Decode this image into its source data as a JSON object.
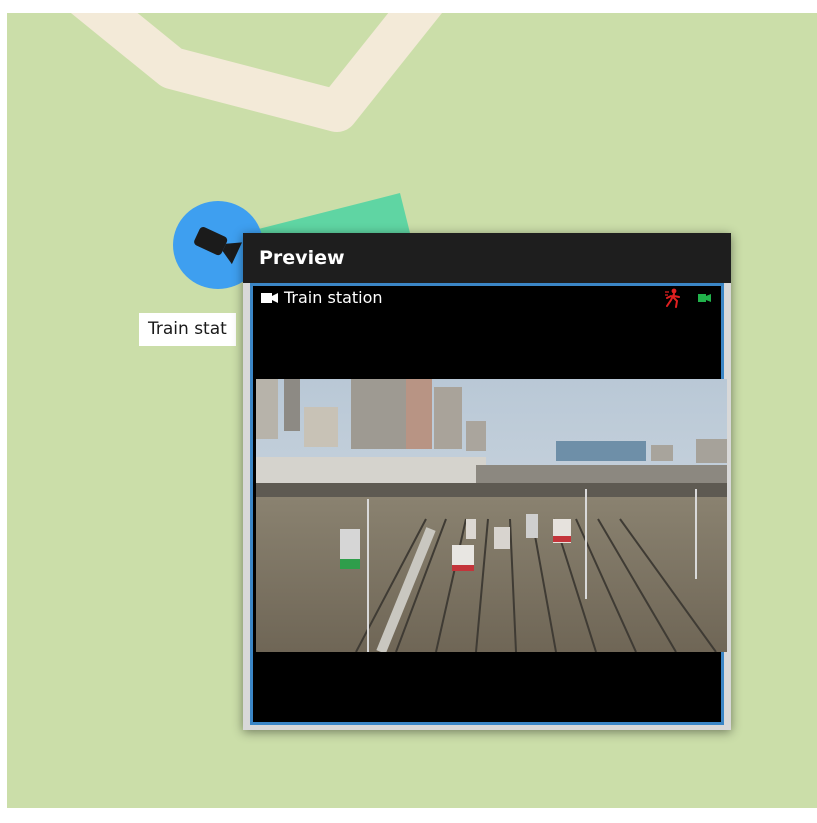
{
  "map": {
    "background_color": "#cbdea9",
    "road_color": "#f3ead8",
    "fov_color": "#5fd5a3"
  },
  "camera_marker": {
    "icon": "camera-icon",
    "color": "#3e9ff0",
    "label": "Train stat"
  },
  "preview": {
    "header": "Preview",
    "camera_name": "Train station",
    "camera_icon": "video-camera-icon",
    "status_icons": [
      "motion-detected-icon",
      "recording-icon"
    ],
    "motion_color": "#e02020",
    "recording_color": "#21b24b",
    "frame_color": "#3b86c6"
  }
}
